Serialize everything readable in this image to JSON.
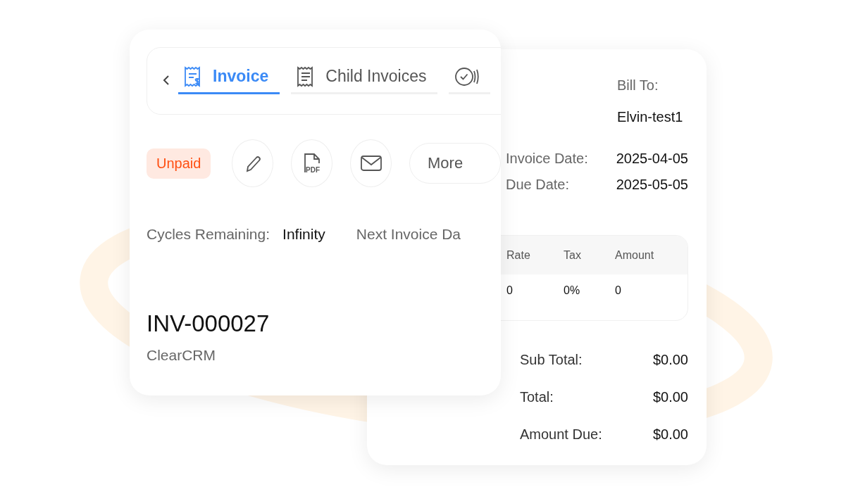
{
  "tabs": [
    {
      "label": "Invoice",
      "selected": true
    },
    {
      "label": "Child Invoices",
      "selected": false
    },
    {
      "selected": false
    }
  ],
  "status_badge": "Unpaid",
  "pdf_label": "PDF",
  "more_button": "More",
  "cycles": {
    "label": "Cycles Remaining:",
    "value": "Infinity"
  },
  "next_invoice_label": "Next Invoice Da",
  "invoice_number": "INV-000027",
  "company": "ClearCRM",
  "bill_to": {
    "label": "Bill To:",
    "name": "Elvin-test1"
  },
  "dates": [
    {
      "label": "Invoice Date:",
      "value": "2025-04-05"
    },
    {
      "label": "Due Date:",
      "value": "2025-05-05"
    }
  ],
  "items_table": {
    "columns": [
      "Rate",
      "Tax",
      "Amount"
    ],
    "rows": [
      [
        "0",
        "0%",
        "0"
      ]
    ]
  },
  "totals": [
    {
      "label": "Sub Total:",
      "value": "$0.00"
    },
    {
      "label": "Total:",
      "value": "$0.00"
    },
    {
      "label": "Amount Due:",
      "value": "$0.00"
    }
  ]
}
